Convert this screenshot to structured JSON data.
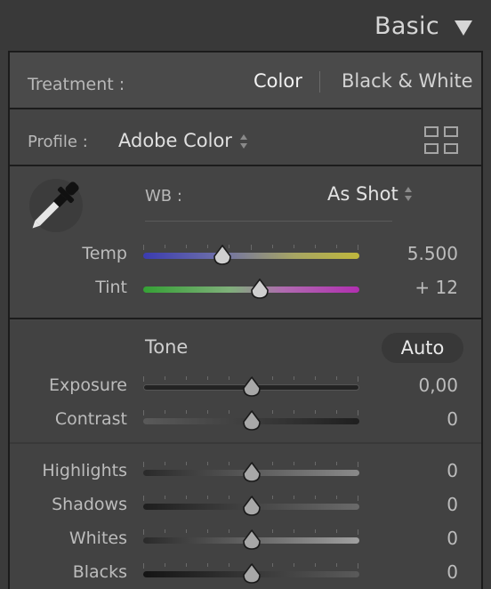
{
  "header": {
    "title": "Basic",
    "collapse_icon": "triangle-down-icon"
  },
  "treatment": {
    "label": "Treatment :",
    "color_option": "Color",
    "bw_option": "Black & White",
    "selected": "Color"
  },
  "profile": {
    "label": "Profile :",
    "value": "Adobe Color",
    "browse_icon": "grid-icon"
  },
  "white_balance": {
    "label": "WB :",
    "value": "As Shot",
    "picker_icon": "eyedropper-icon",
    "sliders": [
      {
        "label": "Temp",
        "value": "5.500",
        "position": 0.365
      },
      {
        "label": "Tint",
        "value": "+ 12",
        "position": 0.54
      }
    ]
  },
  "tone": {
    "title": "Tone",
    "auto_label": "Auto",
    "sliders": [
      {
        "label": "Exposure",
        "value": "0,00",
        "position": 0.5
      },
      {
        "label": "Contrast",
        "value": "0",
        "position": 0.5
      },
      {
        "label": "Highlights",
        "value": "0",
        "position": 0.5
      },
      {
        "label": "Shadows",
        "value": "0",
        "position": 0.5
      },
      {
        "label": "Whites",
        "value": "0",
        "position": 0.5
      },
      {
        "label": "Blacks",
        "value": "0",
        "position": 0.5
      }
    ]
  },
  "colors": {
    "background": "#3b3b3b",
    "panel": "#444444",
    "temp_gradient": [
      "#3e3eb0",
      "#b8b23c"
    ],
    "tint_gradient": [
      "#3aa83a",
      "#b030b0"
    ],
    "neutral_track": "#232323"
  }
}
